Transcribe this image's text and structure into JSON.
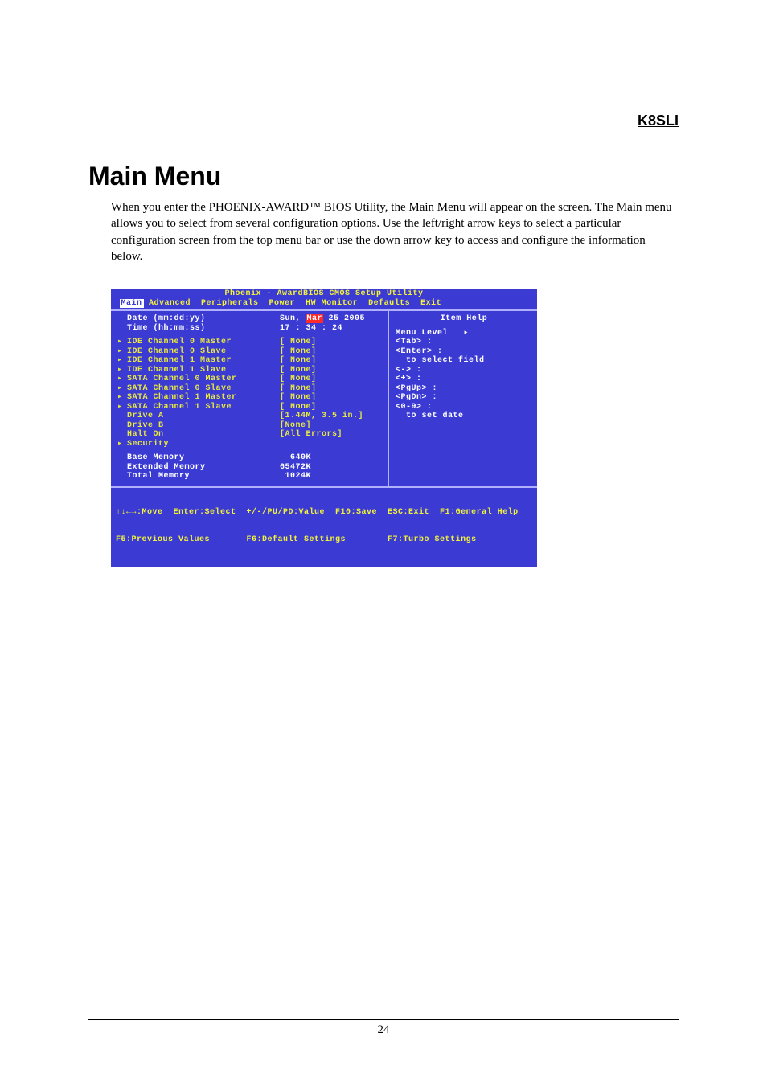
{
  "header_label": "K8SLI",
  "heading": "Main Menu",
  "intro": "When you enter the PHOENIX-AWARD™ BIOS Utility, the Main Menu will appear on the screen. The Main menu allows you to select from several configuration options. Use the left/right arrow keys to select a particular configuration screen from the top menu bar or use the down arrow key to access and configure the information below.",
  "page_number": "24",
  "bios": {
    "title": "Phoenix - AwardBIOS CMOS Setup Utility",
    "menubar": {
      "selected": "Main",
      "rest": " Advanced  Peripherals  Power  HW Monitor  Defaults  Exit"
    },
    "date": {
      "label": "Date (mm:dd:yy)",
      "value_pre": "Sun, ",
      "value_sel": "Mar",
      "value_post": " 25 2005"
    },
    "time": {
      "label": "Time (hh:mm:ss)",
      "value": "17 : 34 : 24"
    },
    "channels": [
      {
        "label": "IDE Channel 0 Master",
        "value": "[ None]"
      },
      {
        "label": "IDE Channel 0 Slave",
        "value": "[ None]"
      },
      {
        "label": "IDE Channel 1 Master",
        "value": "[ None]"
      },
      {
        "label": "IDE Channel 1 Slave",
        "value": "[ None]"
      },
      {
        "label": "SATA Channel 0 Master",
        "value": "[ None]"
      },
      {
        "label": "SATA Channel 0 Slave",
        "value": "[ None]"
      },
      {
        "label": "SATA Channel 1 Master",
        "value": "[ None]"
      },
      {
        "label": "SATA Channel 1 Slave",
        "value": "[ None]"
      }
    ],
    "drive_a": {
      "label": "Drive A",
      "value": "[1.44M, 3.5 in.]"
    },
    "drive_b": {
      "label": "Drive B",
      "value": "[None]"
    },
    "halt_on": {
      "label": "Halt On",
      "value": "[All Errors]"
    },
    "security": {
      "label": "Security"
    },
    "memory": [
      {
        "label": "Base Memory",
        "value": "  640K"
      },
      {
        "label": "Extended Memory",
        "value": "65472K"
      },
      {
        "label": "Total Memory",
        "value": " 1024K"
      }
    ],
    "help": {
      "title": "Item Help",
      "lines": [
        "Menu Level   ▸",
        "",
        "<Tab> :",
        "<Enter> :",
        "  to select field",
        "",
        "<-> :",
        "<+> :",
        "<PgUp> :",
        "<PgDn> :",
        "<0-9> :",
        "  to set date"
      ]
    },
    "footer1": "↑↓←→:Move  Enter:Select  +/-/PU/PD:Value  F10:Save  ESC:Exit  F1:General Help",
    "footer2": "F5:Previous Values       F6:Default Settings        F7:Turbo Settings"
  }
}
